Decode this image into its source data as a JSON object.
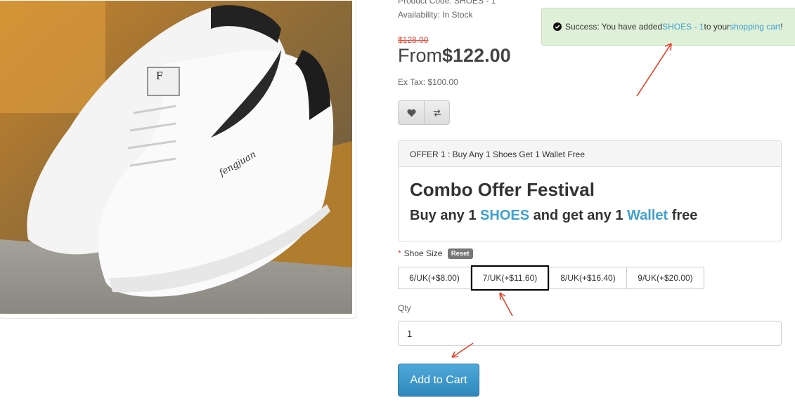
{
  "product": {
    "code": "Product Code: SHOES - 1",
    "availability": "Availability: In Stock",
    "old_price": "$128.00",
    "price_prefix": "From",
    "price": "$122.00",
    "ex_tax": "Ex Tax: $100.00"
  },
  "buttons": {
    "wishlist_icon": "heart-icon",
    "compare_icon": "exchange-icon"
  },
  "offer": {
    "header": "OFFER 1 : Buy Any 1 Shoes Get 1 Wallet Free",
    "title": "Combo Offer Festival",
    "sub_1": "Buy any 1 ",
    "sub_link_1": "SHOES",
    "sub_2": " and get any 1 ",
    "sub_link_2": "Wallet",
    "sub_3": " free",
    "highlight_color": "#3fa0cf"
  },
  "options": {
    "required_mark": "*",
    "size_label": "Shoe Size",
    "reset_label": "Reset",
    "sizes": [
      {
        "label": "6/UK(+$8.00)",
        "selected": false
      },
      {
        "label": "7/UK(+$11.60)",
        "selected": true
      },
      {
        "label": "8/UK(+$16.40)",
        "selected": false
      },
      {
        "label": "9/UK(+$20.00)",
        "selected": false
      }
    ]
  },
  "qty": {
    "label": "Qty",
    "value": "1"
  },
  "cart": {
    "button_label": "Add to Cart",
    "color": "#3a96cc"
  },
  "alert": {
    "prefix": "Success: You have added ",
    "product_link": "SHOES - 1",
    "middle": " to your ",
    "cart_link": "shopping cart",
    "suffix": "!",
    "background": "#dff0d8"
  },
  "annotations": {
    "arrow_color": "#e8432a"
  }
}
